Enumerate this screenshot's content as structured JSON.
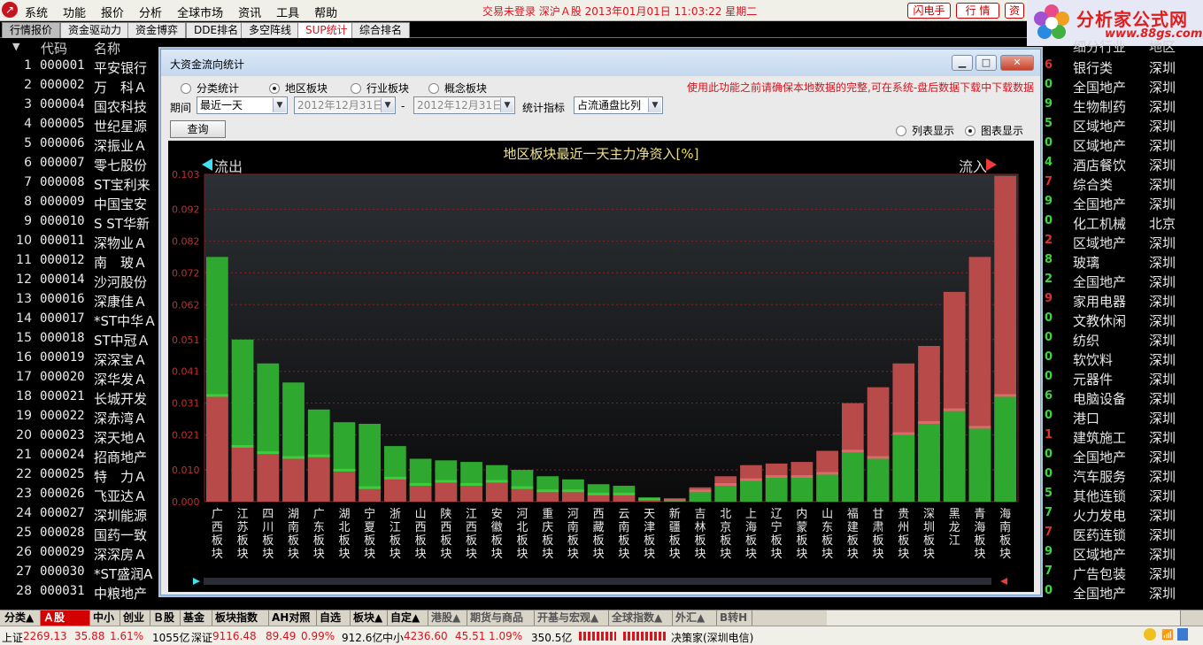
{
  "menu": {
    "items": [
      "系统",
      "功能",
      "报价",
      "分析",
      "全球市场",
      "资讯",
      "工具",
      "帮助"
    ],
    "status": "交易未登录   深沪Ａ股   2013年01月01日  11:03:22  星期二",
    "buttons": [
      "闪电手",
      "行  情",
      "资"
    ]
  },
  "brand": {
    "name": "分析家公式网",
    "url": "www.88gs.com"
  },
  "tabs": [
    {
      "label": "行情报价",
      "active": false
    },
    {
      "label": "资金驱动力",
      "active": false
    },
    {
      "label": "资金博弈",
      "active": false
    },
    {
      "label": "DDE排名",
      "active": false
    },
    {
      "label": "多空阵线",
      "active": false
    },
    {
      "label": "SUP统计",
      "active": true
    },
    {
      "label": "综合排名",
      "active": false
    }
  ],
  "table": {
    "headers": {
      "sort": "▼",
      "code": "代码",
      "name": "名称",
      "ind": "细分行业",
      "reg": "地区"
    },
    "rows": [
      {
        "n": "1",
        "code": "000001",
        "name": "平安银行",
        "ind": "银行类",
        "reg": "深圳",
        "e": "6",
        "ec": "r"
      },
      {
        "n": "2",
        "code": "000002",
        "name": "万　科Ａ",
        "ind": "全国地产",
        "reg": "深圳",
        "e": "0",
        "ec": "g"
      },
      {
        "n": "3",
        "code": "000004",
        "name": "国农科技",
        "ind": "生物制药",
        "reg": "深圳",
        "e": "9",
        "ec": "g"
      },
      {
        "n": "4",
        "code": "000005",
        "name": "世纪星源",
        "ind": "区域地产",
        "reg": "深圳",
        "e": "5",
        "ec": "g"
      },
      {
        "n": "5",
        "code": "000006",
        "name": "深振业Ａ",
        "ind": "区域地产",
        "reg": "深圳",
        "e": "0",
        "ec": "g"
      },
      {
        "n": "6",
        "code": "000007",
        "name": "零七股份",
        "ind": "酒店餐饮",
        "reg": "深圳",
        "e": "4",
        "ec": "g"
      },
      {
        "n": "7",
        "code": "000008",
        "name": "ST宝利来",
        "ind": "综合类",
        "reg": "深圳",
        "e": "7",
        "ec": "r"
      },
      {
        "n": "8",
        "code": "000009",
        "name": "中国宝安",
        "ind": "全国地产",
        "reg": "深圳",
        "e": "9",
        "ec": "g"
      },
      {
        "n": "9",
        "code": "000010",
        "name": "S ST华新",
        "ind": "化工机械",
        "reg": "北京",
        "e": "0",
        "ec": "g"
      },
      {
        "n": "10",
        "code": "000011",
        "name": "深物业Ａ",
        "ind": "区域地产",
        "reg": "深圳",
        "e": "2",
        "ec": "r"
      },
      {
        "n": "11",
        "code": "000012",
        "name": "南　玻Ａ",
        "ind": "玻璃",
        "reg": "深圳",
        "e": "8",
        "ec": "g"
      },
      {
        "n": "12",
        "code": "000014",
        "name": "沙河股份",
        "ind": "全国地产",
        "reg": "深圳",
        "e": "2",
        "ec": "g"
      },
      {
        "n": "13",
        "code": "000016",
        "name": "深康佳Ａ",
        "ind": "家用电器",
        "reg": "深圳",
        "e": "9",
        "ec": "r"
      },
      {
        "n": "14",
        "code": "000017",
        "name": "*ST中华Ａ",
        "ind": "文教休闲",
        "reg": "深圳",
        "e": "0",
        "ec": "g"
      },
      {
        "n": "15",
        "code": "000018",
        "name": "ST中冠Ａ",
        "ind": "纺织",
        "reg": "深圳",
        "e": "0",
        "ec": "g"
      },
      {
        "n": "16",
        "code": "000019",
        "name": "深深宝Ａ",
        "ind": "软饮料",
        "reg": "深圳",
        "e": "0",
        "ec": "g"
      },
      {
        "n": "17",
        "code": "000020",
        "name": "深华发Ａ",
        "ind": "元器件",
        "reg": "深圳",
        "e": "0",
        "ec": "g"
      },
      {
        "n": "18",
        "code": "000021",
        "name": "长城开发",
        "ind": "电脑设备",
        "reg": "深圳",
        "e": "6",
        "ec": "g"
      },
      {
        "n": "19",
        "code": "000022",
        "name": "深赤湾Ａ",
        "ind": "港口",
        "reg": "深圳",
        "e": "0",
        "ec": "g"
      },
      {
        "n": "20",
        "code": "000023",
        "name": "深天地Ａ",
        "ind": "建筑施工",
        "reg": "深圳",
        "e": "1",
        "ec": "r"
      },
      {
        "n": "21",
        "code": "000024",
        "name": "招商地产",
        "ind": "全国地产",
        "reg": "深圳",
        "e": "0",
        "ec": "g"
      },
      {
        "n": "22",
        "code": "000025",
        "name": "特　力Ａ",
        "ind": "汽车服务",
        "reg": "深圳",
        "e": "0",
        "ec": "g"
      },
      {
        "n": "23",
        "code": "000026",
        "name": "飞亚达Ａ",
        "ind": "其他连锁",
        "reg": "深圳",
        "e": "5",
        "ec": "g"
      },
      {
        "n": "24",
        "code": "000027",
        "name": "深圳能源",
        "ind": "火力发电",
        "reg": "深圳",
        "e": "7",
        "ec": "g"
      },
      {
        "n": "25",
        "code": "000028",
        "name": "国药一致",
        "ind": "医药连锁",
        "reg": "深圳",
        "e": "7",
        "ec": "r"
      },
      {
        "n": "26",
        "code": "000029",
        "name": "深深房Ａ",
        "ind": "区域地产",
        "reg": "深圳",
        "e": "9",
        "ec": "g"
      },
      {
        "n": "27",
        "code": "000030",
        "name": "*ST盛润A",
        "ind": "广告包装",
        "reg": "深圳",
        "e": "7",
        "ec": "g"
      },
      {
        "n": "28",
        "code": "000031",
        "name": "中粮地产",
        "ind": "全国地产",
        "reg": "深圳",
        "e": "0",
        "ec": "g"
      }
    ]
  },
  "dialog": {
    "title": "大资金流向统计",
    "radios": [
      {
        "label": "分类统计",
        "checked": false
      },
      {
        "label": "地区板块",
        "checked": true
      },
      {
        "label": "行业板块",
        "checked": false
      },
      {
        "label": "概念板块",
        "checked": false
      }
    ],
    "warning": "使用此功能之前请确保本地数据的完整,可在系统-盘后数据下载中下载数据",
    "period_label": "期间",
    "period_value": "最近一天",
    "date_from": "2012年12月31日",
    "date_to": "2012年12月31日",
    "dash": "-",
    "metric_label": "统计指标",
    "metric_value": "占流通盘比列",
    "query_button": "查询",
    "view_list": "列表显示",
    "view_chart": "图表显示",
    "view_list_checked": false,
    "view_chart_checked": true
  },
  "chart_data": {
    "type": "bar",
    "title": "地区板块最近一天主力净资入",
    "title_unit": "[%]",
    "left_label": "流出",
    "right_label": "流入",
    "ylim": [
      0,
      0.103
    ],
    "yticks": [
      "0.000",
      "0.010",
      "0.021",
      "0.031",
      "0.041",
      "0.051",
      "0.062",
      "0.072",
      "0.082",
      "0.092",
      "0.103"
    ],
    "categories": [
      "广西板块",
      "江苏板块",
      "四川板块",
      "湖南板块",
      "广东板块",
      "湖北板块",
      "宁夏板块",
      "浙江板块",
      "山西板块",
      "陕西板块",
      "江西板块",
      "安徽板块",
      "河北板块",
      "重庆板块",
      "河南板块",
      "西藏板块",
      "云南板块",
      "天津板块",
      "新疆板块",
      "吉林板块",
      "北京板块",
      "上海板块",
      "辽宁板块",
      "内蒙板块",
      "山东板块",
      "福建板块",
      "甘肃板块",
      "贵州板块",
      "深圳板块",
      "黑龙江",
      "青海板块",
      "海南板块"
    ],
    "series": [
      {
        "values": [
          0.077,
          0.051,
          0.0435,
          0.0375,
          0.029,
          0.025,
          0.0245,
          0.0175,
          0.0135,
          0.013,
          0.0125,
          0.0115,
          0.01,
          0.008,
          0.007,
          0.0055,
          0.005,
          0.001,
          0.0003,
          0.0045,
          0.008,
          0.0115,
          0.012,
          0.0125,
          0.016,
          0.031,
          0.036,
          0.0435,
          0.049,
          0.066,
          0.077,
          0.1025
        ]
      },
      {
        "values": [
          0.033,
          0.017,
          0.015,
          0.0135,
          0.014,
          0.0095,
          0.004,
          0.007,
          0.005,
          0.006,
          0.005,
          0.006,
          0.004,
          0.003,
          0.003,
          0.002,
          0.002,
          0.0005,
          0.0002,
          0.003,
          0.005,
          0.0065,
          0.0075,
          0.0075,
          0.0085,
          0.0155,
          0.0135,
          0.021,
          0.0245,
          0.0285,
          0.023,
          0.033
        ]
      }
    ],
    "colors": {
      "red": "#b84a4a",
      "green": "#2fa82f",
      "background": "#0f1012"
    }
  },
  "bottom_tabs": [
    {
      "label": "分类▲",
      "active": false
    },
    {
      "label": "Ａ股",
      "active": true
    },
    {
      "label": "中小",
      "active": false
    },
    {
      "label": "创业",
      "active": false
    },
    {
      "label": "Ｂ股",
      "active": false
    },
    {
      "label": "基金",
      "active": false
    },
    {
      "label": "板块指数",
      "active": false
    },
    {
      "label": "AH对照",
      "active": false
    },
    {
      "label": "自选",
      "active": false
    },
    {
      "label": "板块▲",
      "active": false
    },
    {
      "label": "自定▲",
      "active": false
    },
    {
      "label": "港股▲",
      "active": false
    },
    {
      "label": "期货与商品▲",
      "active": false
    },
    {
      "label": "开基与宏观▲",
      "active": false
    },
    {
      "label": "全球指数▲",
      "active": false
    },
    {
      "label": "外汇▲",
      "active": false
    },
    {
      "label": "B转H",
      "active": false
    }
  ],
  "status_bar": {
    "sh_label": "上证",
    "sh_index": "2269.13",
    "sh_change": "35.88",
    "sh_pct": "1.61%",
    "sh_amount": "1055亿",
    "sz_label": "深证",
    "sz_index": "9116.48",
    "sz_change": "89.49",
    "sz_pct": "0.99%",
    "sz_amount": "912.6亿",
    "zx_label": "中小",
    "zx_index": "4236.60",
    "zx_change": "45.51",
    "zx_pct": "1.09%",
    "zx_amount": "350.5亿",
    "broker": "决策家(深圳电信)"
  }
}
